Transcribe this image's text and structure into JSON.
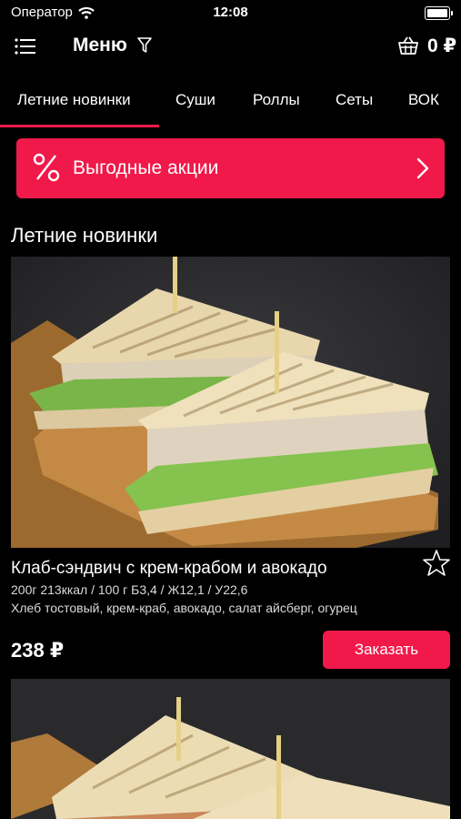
{
  "status_bar": {
    "carrier": "Оператор",
    "time": "12:08"
  },
  "nav": {
    "title": "Меню",
    "cart_total": "0 ₽"
  },
  "tabs": [
    {
      "label": "Летние новинки",
      "active": true
    },
    {
      "label": "Суши"
    },
    {
      "label": "Роллы"
    },
    {
      "label": "Сеты"
    },
    {
      "label": "ВОК"
    }
  ],
  "promo": {
    "label": "Выгодные акции"
  },
  "section": {
    "title": "Летние новинки"
  },
  "products": [
    {
      "name": "Клаб-сэндвич с крем-крабом и авокадо",
      "meta": "200г 213ккал / 100 г Б3,4 / Ж12,1 / У22,6",
      "description": "Хлеб тостовый, крем-краб, авокадо, салат айсберг, огурец",
      "price": "238 ₽",
      "order_label": "Заказать"
    }
  ],
  "colors": {
    "accent": "#f0194a",
    "background": "#000000",
    "card_bg": "#2b2b2e"
  },
  "icons": [
    "wifi-icon",
    "battery-icon",
    "menu-list-icon",
    "filter-icon",
    "basket-icon",
    "percent-icon",
    "chevron-right-icon",
    "star-outline-icon"
  ]
}
